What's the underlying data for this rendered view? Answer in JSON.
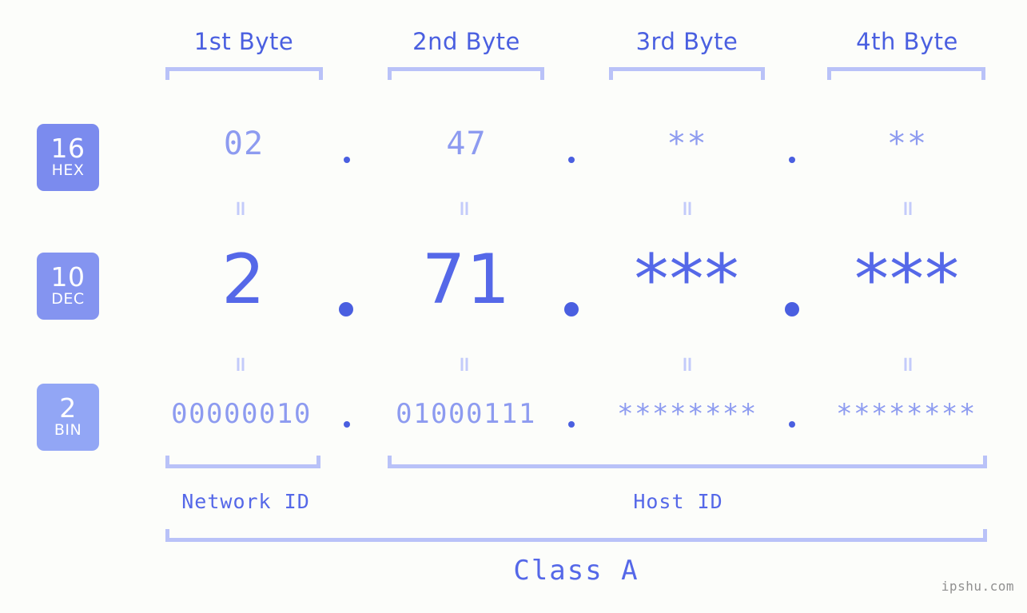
{
  "page": {
    "background_color": "#fcfdfa",
    "accent_color": "#5568e8",
    "muted_accent_color": "#8d9bf0",
    "bracket_color": "#b9c2f8",
    "watermark": "ipshu.com"
  },
  "byte_headers": [
    {
      "label": "1st Byte"
    },
    {
      "label": "2nd Byte"
    },
    {
      "label": "3rd Byte"
    },
    {
      "label": "4th Byte"
    }
  ],
  "rows": [
    {
      "badge_number": "16",
      "badge_label": "HEX",
      "badge_color": "#7b8bee",
      "values": [
        "02",
        "47",
        "**",
        "**"
      ],
      "separator": "."
    },
    {
      "badge_number": "10",
      "badge_label": "DEC",
      "badge_color": "#8494f0",
      "values": [
        "2",
        "71",
        "***",
        "***"
      ],
      "separator": "."
    },
    {
      "badge_number": "2",
      "badge_label": "BIN",
      "badge_color": "#92a6f5",
      "values": [
        "00000010",
        "01000111",
        "********",
        "********"
      ],
      "separator": "."
    }
  ],
  "equals_mark": "=",
  "sections": [
    {
      "label": "Network ID"
    },
    {
      "label": "Host ID"
    }
  ],
  "class": {
    "label": "Class A"
  }
}
